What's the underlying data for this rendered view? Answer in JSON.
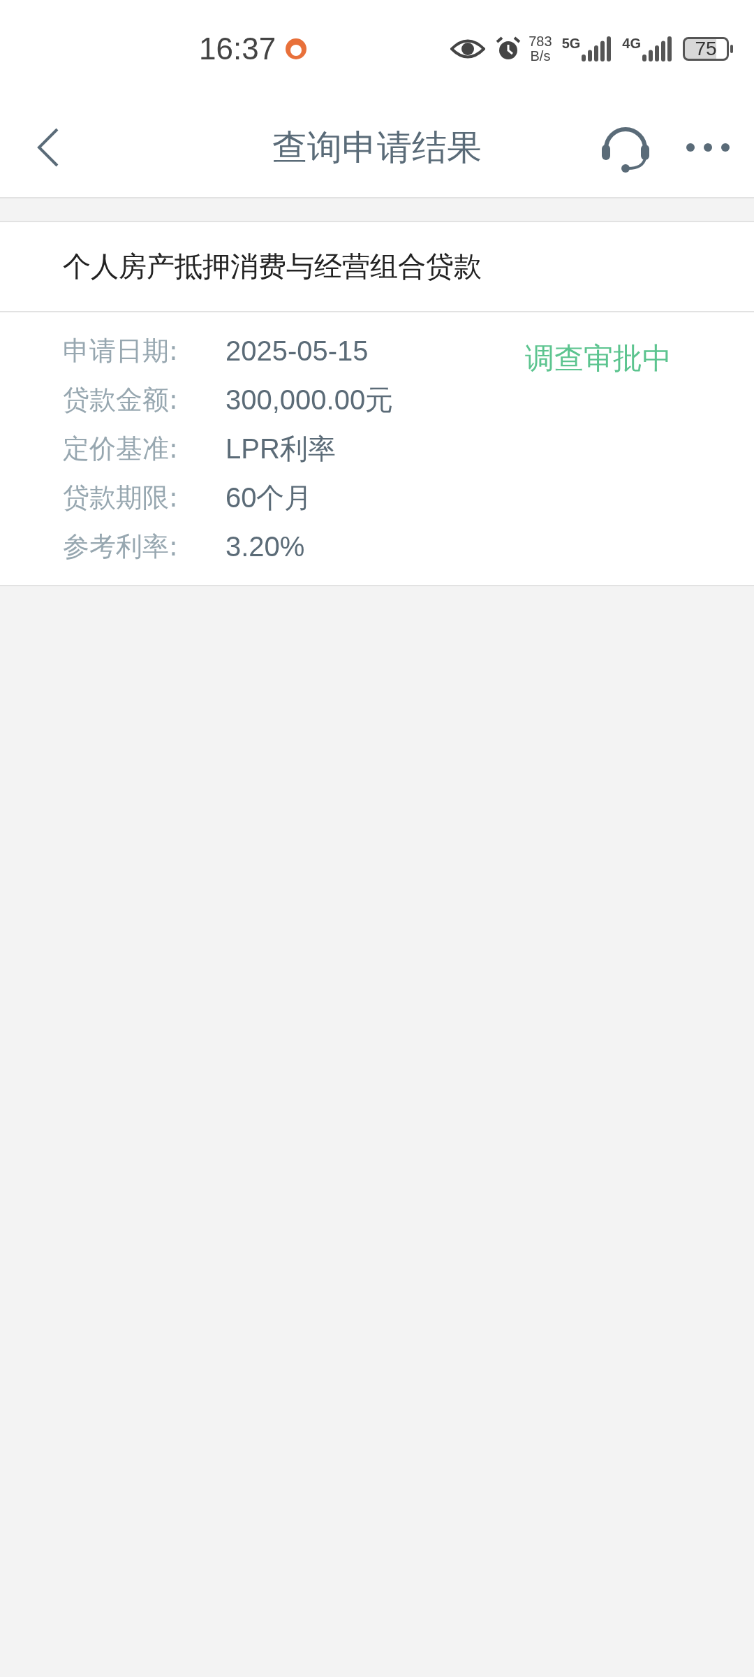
{
  "status_bar": {
    "time": "16:37",
    "speed_value": "783",
    "speed_unit": "B/s",
    "network_1": "5G",
    "network_2": "4G",
    "battery": "75"
  },
  "nav": {
    "title": "查询申请结果"
  },
  "loan": {
    "product": "个人房产抵押消费与经营组合贷款",
    "status": "调查审批中",
    "fields": [
      {
        "label": "申请日期:",
        "value": "2025-05-15"
      },
      {
        "label": "贷款金额:",
        "value": "300,000.00元"
      },
      {
        "label": "定价基准:",
        "value": "LPR利率"
      },
      {
        "label": "贷款期限:",
        "value": "60个月"
      },
      {
        "label": "参考利率:",
        "value": "3.20%"
      }
    ]
  }
}
